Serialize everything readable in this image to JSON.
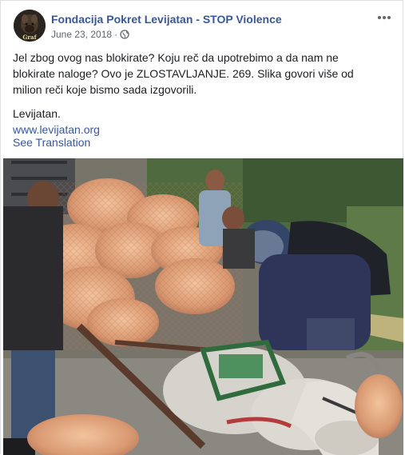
{
  "post": {
    "page_name": "Fondacija Pokret Levijatan - STOP Violence",
    "date": "June 23, 2018",
    "separator": "·",
    "avatar_text": "Graf",
    "body_lines": [
      "Jel zbog ovog nas blokirate? Koju reč da upotrebimo a da nam ne",
      "blokirate naloge? Ovo je ZLOSTAVLJANJE. 269. Slika govori više od",
      "milion reči koje bismo sada izgovorili."
    ],
    "signature": "Levijatan.",
    "website": "www.levijatan.org",
    "see_translation": "See Translation",
    "privacy_icon": "globe-icon",
    "menu_icon": "more-options-icon"
  },
  "colors": {
    "link_blue": "#385898",
    "meta_gray": "#616770",
    "text": "#1c1e21"
  }
}
